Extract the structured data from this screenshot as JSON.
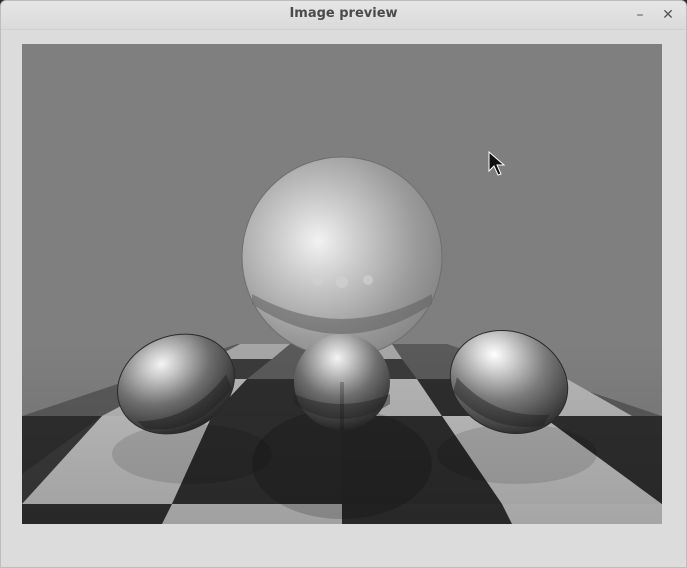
{
  "window": {
    "title": "Image preview",
    "controls": {
      "minimize_icon": "minimize-icon",
      "close_icon": "close-icon"
    }
  },
  "preview": {
    "image_description_icon": "rendered-scene",
    "colors": {
      "background": "#7f7f7f",
      "floor_light": "#b3b3b3",
      "floor_dark": "#2f2f2f"
    }
  }
}
